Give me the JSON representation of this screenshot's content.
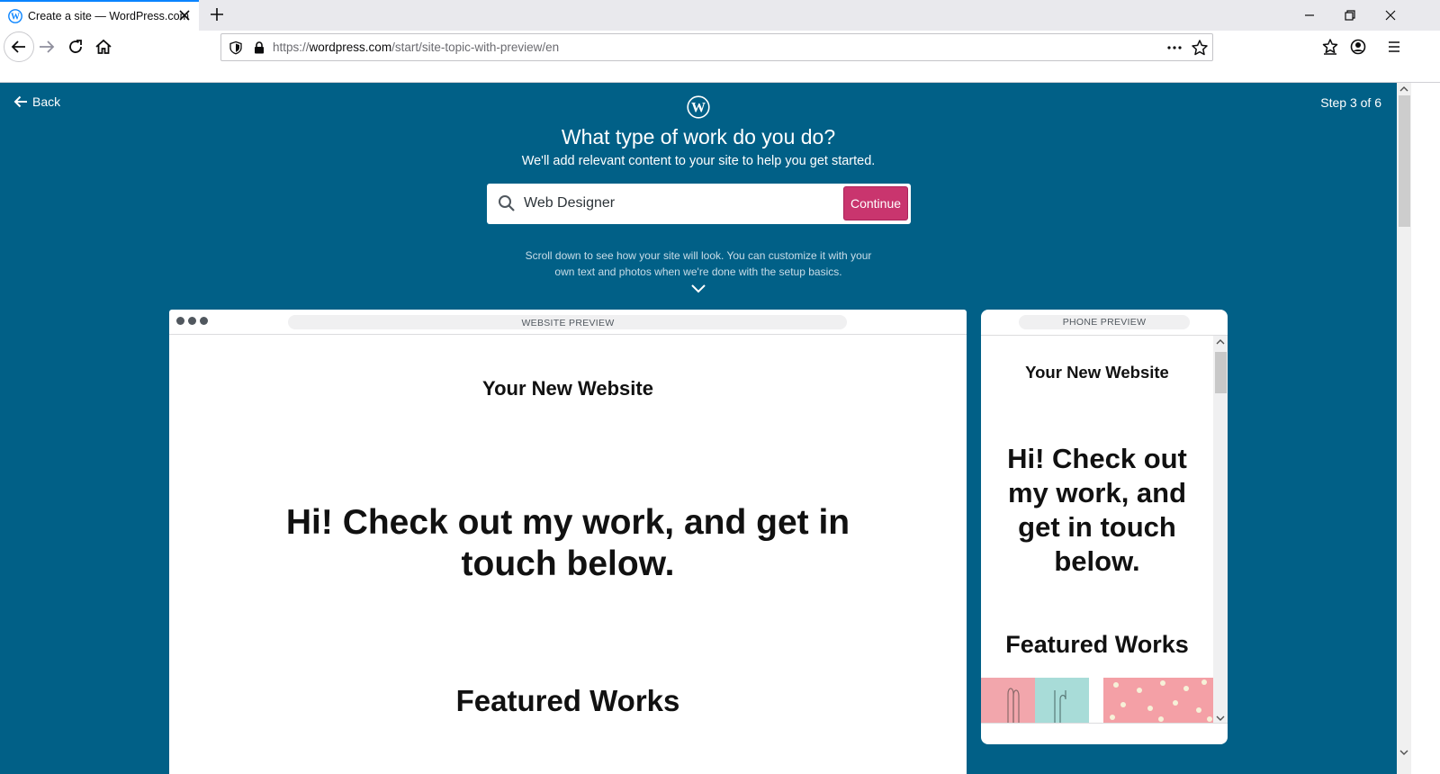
{
  "browser": {
    "tab_title": "Create a site — WordPress.com",
    "url_prefix": "https://",
    "url_domain": "wordpress.com",
    "url_path": "/start/site-topic-with-preview/en"
  },
  "header": {
    "back_label": "Back",
    "step_text": "Step 3 of 6"
  },
  "main": {
    "title": "What type of work do you do?",
    "subtitle": "We'll add relevant content to your site to help you get started.",
    "search_value": "Web Designer",
    "continue_label": "Continue",
    "hint_line1": "Scroll down to see how your site will look. You can customize it with your",
    "hint_line2": "own text and photos when we're done with the setup basics."
  },
  "website_preview": {
    "label": "WEBSITE PREVIEW",
    "site_name": "Your New Website",
    "hero": "Hi! Check out my work, and get in touch below.",
    "featured": "Featured Works"
  },
  "phone_preview": {
    "label": "PHONE PREVIEW",
    "site_name": "Your New Website",
    "hero": "Hi! Check out my work, and get in touch below.",
    "featured": "Featured Works"
  },
  "colors": {
    "page_bg": "#016087",
    "accent": "#c9356e"
  },
  "icons": [
    "wordpress-icon",
    "close-icon",
    "plus-icon",
    "arrow-left-icon",
    "arrow-right-icon",
    "reload-icon",
    "home-icon",
    "shield-icon",
    "lock-icon",
    "more-icon",
    "star-icon",
    "search-icon",
    "chevron-down-icon"
  ]
}
